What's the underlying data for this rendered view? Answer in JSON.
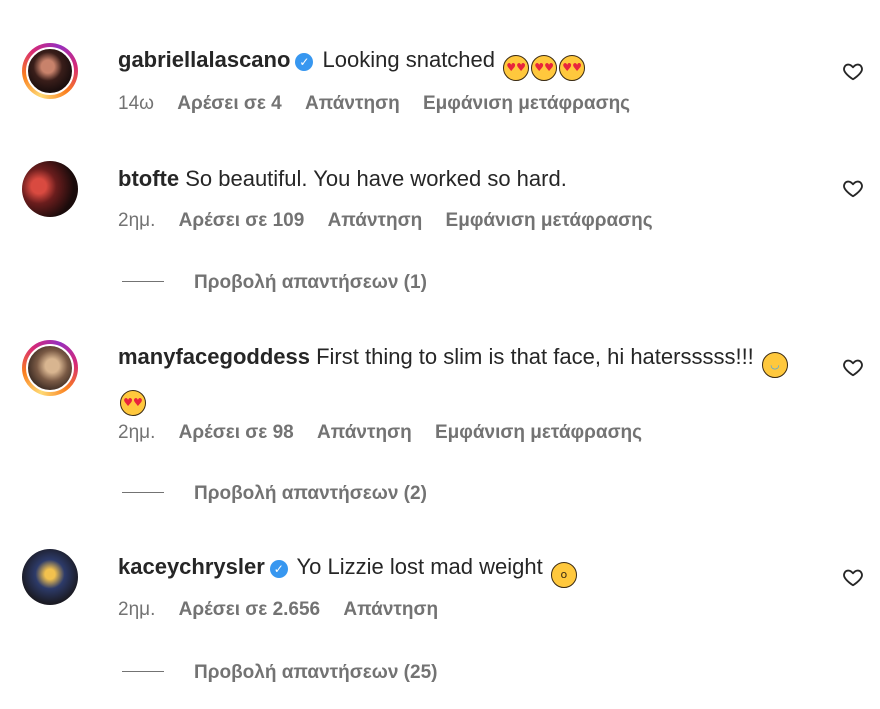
{
  "comments": [
    {
      "username": "gabriellalascano",
      "verified": true,
      "text": "Looking snatched",
      "emojis": [
        "smiling-heart-eyes",
        "smiling-heart-eyes",
        "smiling-heart-eyes"
      ],
      "time": "14ω",
      "likes": "Αρέσει σε 4",
      "reply": "Απάντηση",
      "translate": "Εμφάνιση μετάφρασης",
      "story_ring": true
    },
    {
      "username": "btofte",
      "verified": false,
      "text": "So beautiful. You have worked so hard.",
      "emojis": [],
      "time": "2ημ.",
      "likes": "Αρέσει σε 109",
      "reply": "Απάντηση",
      "translate": "Εμφάνιση μετάφρασης",
      "view_replies": "Προβολή απαντήσεων (1)",
      "story_ring": false
    },
    {
      "username": "manyfacegoddess",
      "verified": false,
      "text": "First thing to slim is that face, hi hatersssss!!!",
      "emojis": [
        "tears-of-joy",
        "smiling-heart-eyes"
      ],
      "time": "2ημ.",
      "likes": "Αρέσει σε 98",
      "reply": "Απάντηση",
      "translate": "Εμφάνιση μετάφρασης",
      "view_replies": "Προβολή απαντήσεων (2)",
      "story_ring": true
    },
    {
      "username": "kaceychrysler",
      "verified": true,
      "text": "Yo Lizzie lost mad weight",
      "emojis": [
        "astonished-face"
      ],
      "time": "2ημ.",
      "likes": "Αρέσει σε 2.656",
      "reply": "Απάντηση",
      "translate": "",
      "view_replies": "Προβολή απαντήσεων (25)",
      "story_ring": false
    }
  ],
  "icons": {
    "like": "heart-outline-icon",
    "verified": "verified-badge-icon"
  },
  "colors": {
    "text": "#262626",
    "secondary": "#737373",
    "verified": "#3797f0"
  }
}
